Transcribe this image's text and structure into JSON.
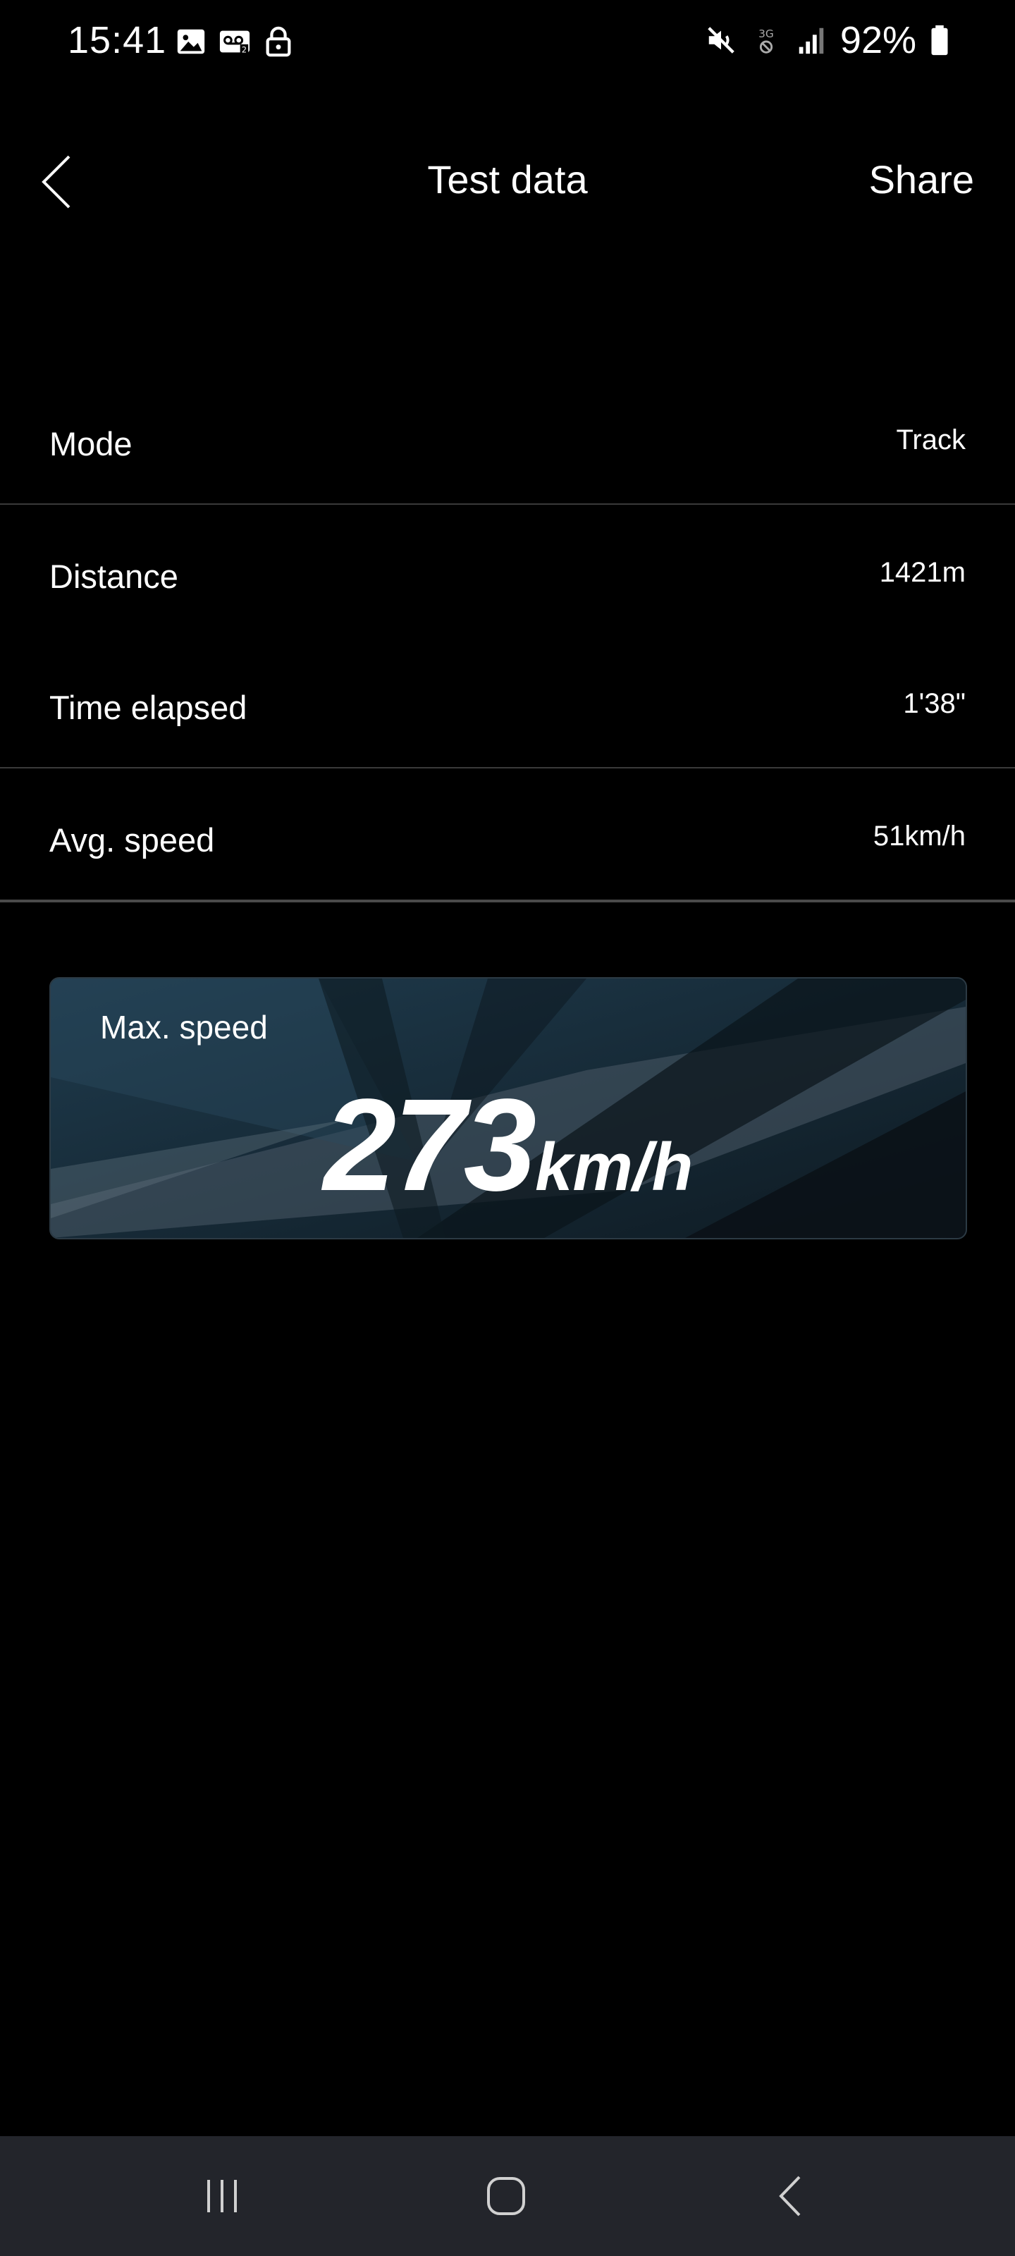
{
  "status_bar": {
    "time": "15:41",
    "battery": "92%",
    "network": "3G",
    "icons": [
      "image-icon",
      "voicemail-icon",
      "lock-icon",
      "mute-icon",
      "signal-icon",
      "battery-icon"
    ]
  },
  "header": {
    "title": "Test data",
    "share_label": "Share",
    "back_icon": "chevron-left-icon"
  },
  "rows": [
    {
      "label": "Mode",
      "value": "Track"
    },
    {
      "label": "Distance",
      "value": "1421m"
    },
    {
      "label": "Time elapsed",
      "value": "1'38\""
    },
    {
      "label": "Avg. speed",
      "value": "51km/h"
    }
  ],
  "max_speed": {
    "label": "Max. speed",
    "value": "273",
    "unit": "km/h"
  },
  "nav_bar": {
    "recents_icon": "recents-icon",
    "home_icon": "home-icon",
    "back_icon": "back-icon"
  },
  "colors": {
    "background": "#000000",
    "text": "#ffffff",
    "divider": "#3a3a3a",
    "card_bg": "#16242e",
    "nav_bg": "#23252b"
  }
}
